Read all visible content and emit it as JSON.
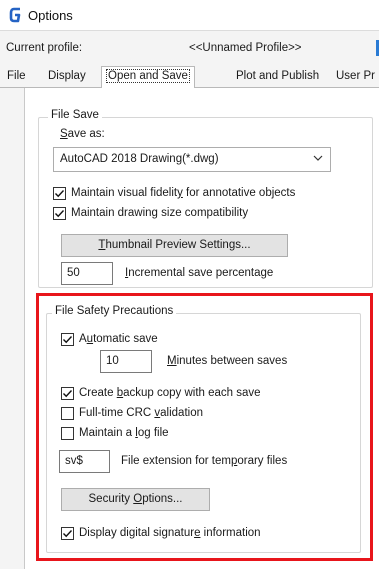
{
  "window": {
    "title": "Options"
  },
  "profile": {
    "label": "Current profile:",
    "value": "<<Unnamed Profile>>"
  },
  "tabs": [
    {
      "label": "File",
      "active": false
    },
    {
      "label": "Display",
      "active": false
    },
    {
      "label": "Open and Save",
      "active": true
    },
    {
      "label": "Plot and Publish",
      "active": false
    },
    {
      "label": "User Pr",
      "active": false
    }
  ],
  "file_save": {
    "title": "File Save",
    "save_as_label_first": "S",
    "save_as_label_rest": "ave as:",
    "save_as_value": "AutoCAD 2018 Drawing(*.dwg)",
    "visual_fidelity": {
      "pre": "Maintain visual fidelit",
      "key": "y",
      "post": " for annotative objects",
      "checked": true
    },
    "drawing_size": {
      "pre": "Maintain drawin",
      "key": "g",
      "post": " size compatibility",
      "checked": true
    },
    "thumbnail_button": {
      "key": "T",
      "rest": "humbnail Preview Settings..."
    },
    "incremental": {
      "value": "50",
      "key": "I",
      "rest": "ncremental save percentage"
    }
  },
  "file_safety": {
    "title": "File Safety Precautions",
    "automatic_save": {
      "pre": "A",
      "key": "u",
      "post": "tomatic save",
      "checked": true
    },
    "minutes": {
      "value": "10",
      "key": "M",
      "rest": "inutes between saves"
    },
    "backup": {
      "pre": "Create ",
      "key": "b",
      "post": "ackup copy with each save",
      "checked": true
    },
    "crc": {
      "pre": "Full-time CRC ",
      "key": "v",
      "post": "alidation",
      "checked": false
    },
    "log": {
      "pre": "Maintain a ",
      "key": "l",
      "post": "og file",
      "checked": false
    },
    "extension": {
      "value": "sv$",
      "pre": "File extension for tem",
      "key": "p",
      "post": "orary files"
    },
    "security_button": {
      "pre": "Security ",
      "key": "O",
      "post": "ptions..."
    },
    "signature": {
      "pre": "Display digital signatur",
      "key": "e",
      "post": " information",
      "checked": true
    }
  },
  "colors": {
    "highlight": "#e8151b",
    "accent": "#2a7bd4",
    "logo": "#2563c4"
  },
  "icons": {
    "logo": "autocad-g-icon",
    "dropdown": "chevron-down-icon",
    "check": "checkmark-icon"
  }
}
